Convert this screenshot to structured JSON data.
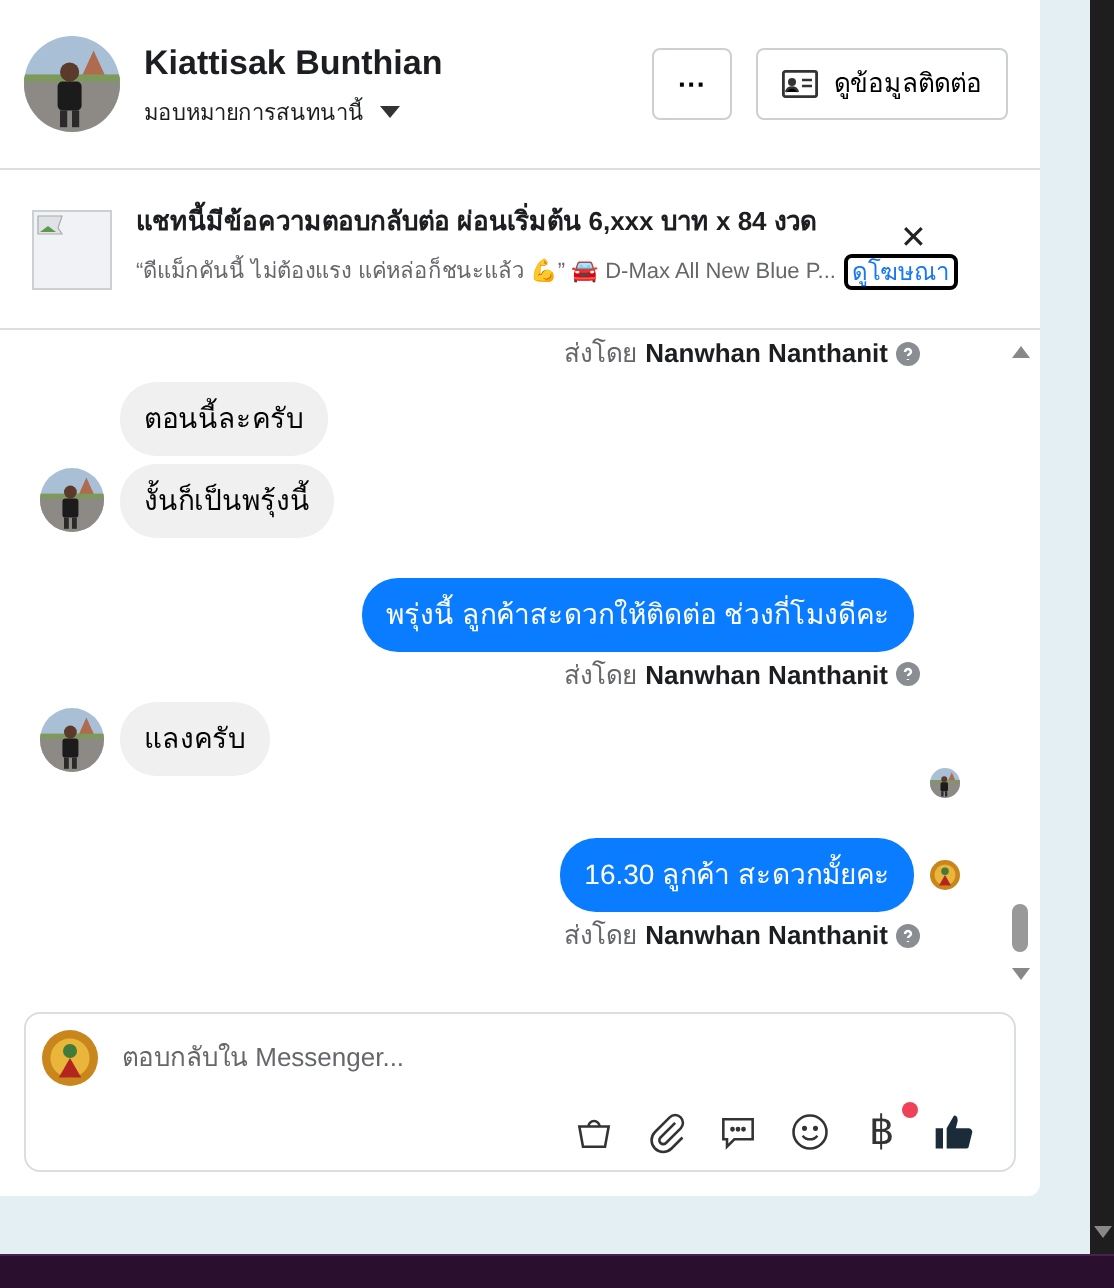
{
  "header": {
    "name": "Kiattisak Bunthian",
    "subtitle": "มอบหมายการสนทนานี้",
    "more_button": "···",
    "contact_button": "ดูข้อมูลติดต่อ"
  },
  "ad": {
    "title": "แชทนี้มีข้อความตอบกลับต่อ ผ่อนเริ่มต้น 6,xxx บาท x 84 งวด",
    "text": "“ดีแม็กคันนี้ ไม่ต้องแรง แค่หล่อก็ชนะแล้ว 💪” 🚘 D-Max All New Blue P...",
    "link": "ดูโฆษณา",
    "close": "✕"
  },
  "messages": [
    {
      "kind": "sent_by",
      "prefix": "ส่งโดย",
      "name": "Nanwhan Nanthanit"
    },
    {
      "kind": "incoming",
      "text": "ตอนนี้ละครับ",
      "avatar": false
    },
    {
      "kind": "incoming",
      "text": "งั้นก็เป็นพรุ้งนี้",
      "avatar": true
    },
    {
      "kind": "outgoing",
      "text": "พรุ่งนี้ ลูกค้าสะดวกให้ติดต่อ ช่วงกี่โมงดีคะ",
      "receipt": false
    },
    {
      "kind": "sent_by",
      "prefix": "ส่งโดย",
      "name": "Nanwhan Nanthanit"
    },
    {
      "kind": "incoming",
      "text": "แลงครับ",
      "avatar": true
    },
    {
      "kind": "read_receipt"
    },
    {
      "kind": "outgoing",
      "text": "16.30 ลูกค้า  สะดวกมั้ยคะ",
      "receipt": true
    },
    {
      "kind": "sent_by",
      "prefix": "ส่งโดย",
      "name": "Nanwhan Nanthanit"
    }
  ],
  "composer": {
    "placeholder": "ตอบกลับใน Messenger...",
    "tools": [
      {
        "kind": "bag",
        "badge": false
      },
      {
        "kind": "clip",
        "badge": false
      },
      {
        "kind": "chat",
        "badge": false
      },
      {
        "kind": "smile",
        "badge": false
      },
      {
        "kind": "baht",
        "symbol": "฿",
        "badge": true
      },
      {
        "kind": "like",
        "badge": false
      }
    ]
  }
}
